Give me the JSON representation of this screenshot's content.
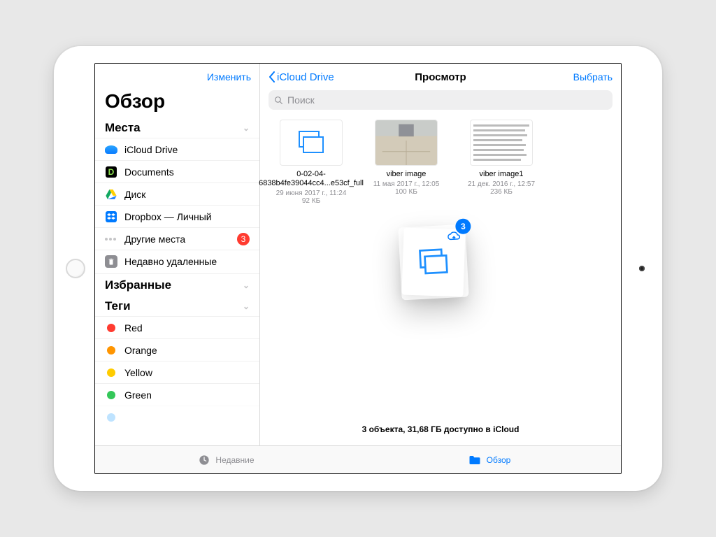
{
  "sidebar": {
    "edit": "Изменить",
    "title": "Обзор",
    "locations_header": "Места",
    "items": [
      {
        "label": "iCloud Drive"
      },
      {
        "label": "Documents"
      },
      {
        "label": "Диск"
      },
      {
        "label": "Dropbox — Личный"
      },
      {
        "label": "Другие места",
        "badge": "3"
      },
      {
        "label": "Недавно удаленные"
      }
    ],
    "favorites_header": "Избранные",
    "tags_header": "Теги",
    "tags": [
      {
        "label": "Red",
        "color": "#ff3b30"
      },
      {
        "label": "Orange",
        "color": "#ff9500"
      },
      {
        "label": "Yellow",
        "color": "#ffcc00"
      },
      {
        "label": "Green",
        "color": "#34c759"
      }
    ]
  },
  "main": {
    "back_label": "iCloud Drive",
    "title": "Просмотр",
    "select": "Выбрать",
    "search_placeholder": "Поиск",
    "files": [
      {
        "name": "0-02-04-6838b4fe39044cc4...e53cf_full",
        "meta": "29 июня 2017 г., 11:24",
        "size": "92 КБ"
      },
      {
        "name": "viber image",
        "meta": "11 мая 2017 г., 12:05",
        "size": "100 КБ"
      },
      {
        "name": "viber image1",
        "meta": "21 дек. 2016 г., 12:57",
        "size": "236 КБ"
      }
    ],
    "upload_badge": "3",
    "status": "3 объекта, 31,68 ГБ доступно в iCloud"
  },
  "toolbar": {
    "recents": "Недавние",
    "browse": "Обзор"
  }
}
